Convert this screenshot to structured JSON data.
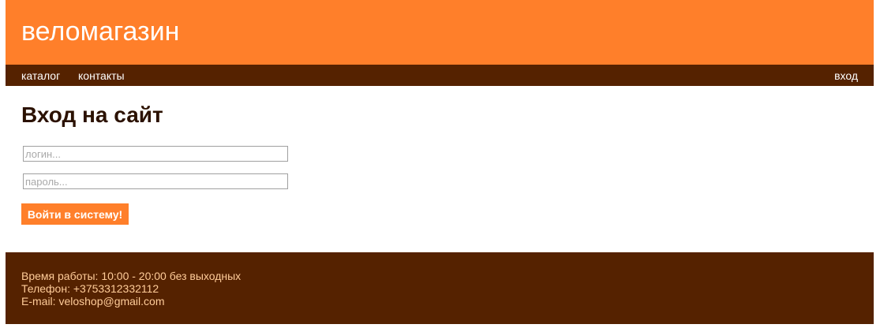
{
  "header": {
    "site_title": "веломагазин"
  },
  "nav": {
    "catalog": "каталог",
    "contacts": "контакты",
    "login": "вход"
  },
  "main": {
    "heading": "Вход на сайт",
    "login_placeholder": "логин...",
    "password_placeholder": "пароль...",
    "submit_label": "Войти в систему!"
  },
  "footer": {
    "hours": "Время работы: 10:00 - 20:00 без выходных",
    "phone": "Телефон: +3753312332112",
    "email": "E-mail: veloshop@gmail.com"
  },
  "colors": {
    "accent_orange": "#ff7f2a",
    "dark_brown": "#552200",
    "footer_text": "#ffcc99"
  }
}
